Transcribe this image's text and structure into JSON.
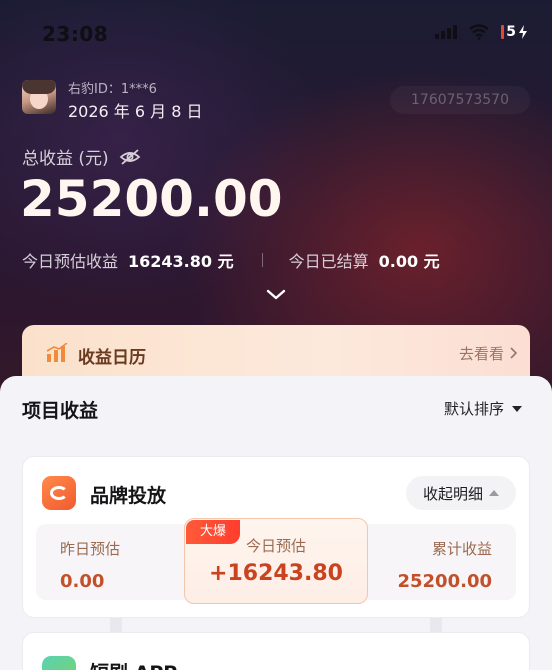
{
  "status_bar": {
    "time": "23:08",
    "battery": "5"
  },
  "header": {
    "user_id": "右豹ID：1***6",
    "date": "2026 年 6 月 8 日",
    "phone": "17607573570"
  },
  "summary": {
    "total_label": "总收益 (元)",
    "total_amount": "25200.00",
    "today_estimate_label": "今日预估收益",
    "today_estimate_value": "16243.80 元",
    "today_settled_label": "今日已结算",
    "today_settled_value": "0.00 元"
  },
  "calendar": {
    "title": "收益日历",
    "link": "去看看"
  },
  "projects": {
    "title": "项目收益",
    "sort_label": "默认排序",
    "items": [
      {
        "name": "品牌投放",
        "toggle_label": "收起明细",
        "yesterday_label": "昨日预估",
        "yesterday_value": "0.00",
        "today_badge": "大爆",
        "today_label": "今日预估",
        "today_value": "+16243.80",
        "total_label": "累计收益",
        "total_value": "25200.00"
      },
      {
        "name": "短剧 APP"
      }
    ]
  },
  "colors": {
    "accent": "#c8431e",
    "banner": "#fbe1cb",
    "badge": "#ff4a34"
  }
}
